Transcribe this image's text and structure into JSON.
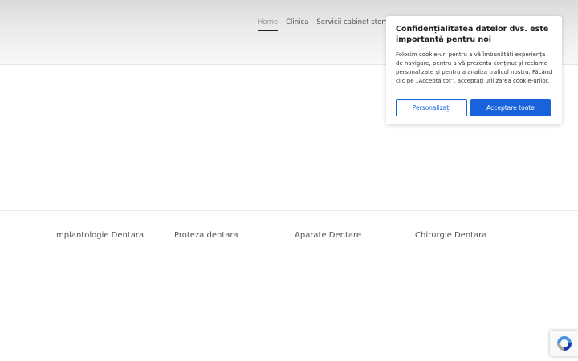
{
  "nav": {
    "items": [
      {
        "label": "Home",
        "active": true
      },
      {
        "label": "Clinica"
      },
      {
        "label": "Servicii cabinet stomatologic"
      }
    ]
  },
  "services": [
    {
      "label": "Implantologie Dentara"
    },
    {
      "label": "Proteza dentara"
    },
    {
      "label": "Aparate Dentare"
    },
    {
      "label": "Chirurgie Dentara"
    }
  ],
  "cookie_banner": {
    "title": "Confidențialitatea datelor dvs. este importantă pentru noi",
    "text": "Folosim cookie-uri pentru a vă îmbunătăți experiența de navigare, pentru a vă prezenta conținut și reclame personalizate și pentru a analiza traficul nostru. Făcând clic pe „Acceptă tot”, acceptați utilizarea cookie-urilor.",
    "customize_label": "Personalizați",
    "accept_label": "Acceptare toate"
  },
  "colors": {
    "accent": "#1863dc"
  },
  "icons": {
    "recaptcha": "recaptcha-icon"
  }
}
